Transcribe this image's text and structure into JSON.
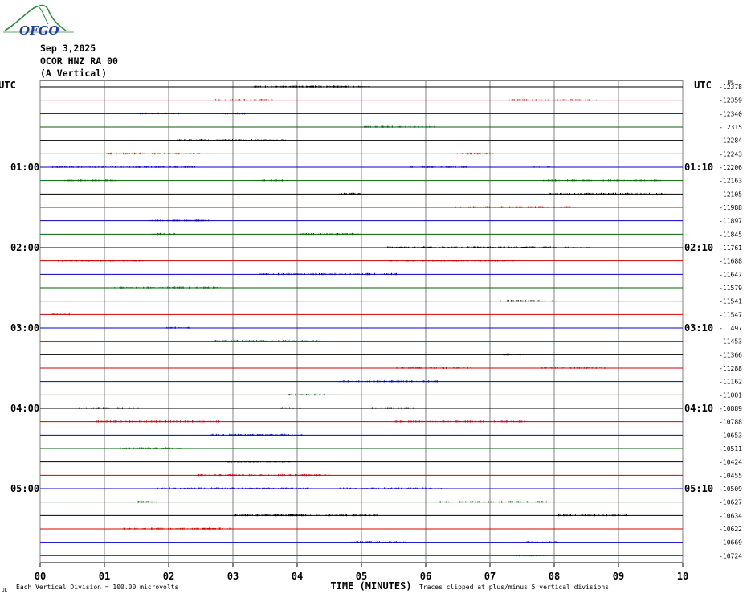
{
  "logo": {
    "text": "OFGO",
    "name": "ofgo-logo"
  },
  "header": {
    "date": "Sep 3,2025",
    "station": "OCOR HNZ RA 00",
    "component": "(A Vertical)"
  },
  "chart_data": {
    "type": "line",
    "title": "",
    "left_axis_label": "UTC",
    "right_axis_label": "UTC",
    "right_top_label": "DC",
    "xlabel": "TIME (MINUTES)",
    "xticks": [
      "00",
      "01",
      "02",
      "03",
      "04",
      "05",
      "06",
      "07",
      "08",
      "09",
      "10"
    ],
    "xlim": [
      0,
      10
    ],
    "left_time_labels": [
      "01:00",
      "02:00",
      "03:00",
      "04:00",
      "05:00"
    ],
    "right_time_labels": [
      "01:10",
      "02:10",
      "03:10",
      "04:10",
      "05:10"
    ],
    "row_colors": [
      "#000000",
      "#d40000",
      "#0000c8",
      "#006400"
    ],
    "dc_offsets": [
      "-12378",
      "-12359",
      "-12340",
      "-12315",
      "-12284",
      "-12243",
      "-12206",
      "-12163",
      "-12105",
      "-11988",
      "-11897",
      "-11845",
      "-11761",
      "-11688",
      "-11647",
      "-11579",
      "-11541",
      "-11547",
      "-11497",
      "-11453",
      "-11366",
      "-11288",
      "-11162",
      "-11001",
      "-10889",
      "-10788",
      "-10653",
      "-10511",
      "-10424",
      "-10455",
      "-10509",
      "-10627",
      "-10634",
      "-10622",
      "-10669",
      "-10724"
    ],
    "footer_left": "Each Vertical Division =  100.00 microvolts",
    "footer_right": "Traces clipped at plus/minus 5 vertical divisions",
    "footer_mark": "UL"
  }
}
